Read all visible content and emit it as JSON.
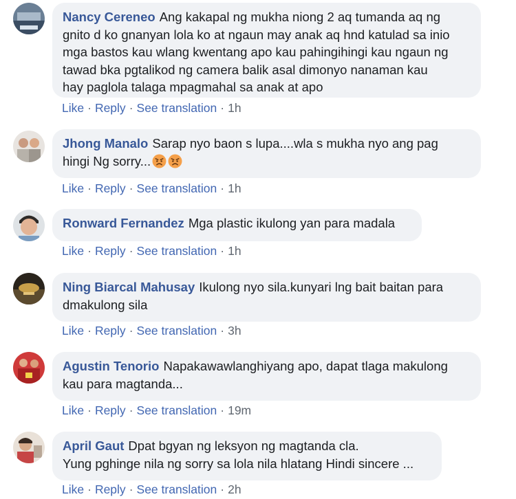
{
  "actions": {
    "like": "Like",
    "reply": "Reply",
    "see_translation": "See translation",
    "separator": "·"
  },
  "comments": [
    {
      "author": "Nancy Cereneo",
      "text": "Ang kakapal ng mukha niong 2 aq tumanda aq ng\ngnito d ko gnanyan lola ko at ngaun may anak aq hnd katulad sa inio\nmga bastos kau wlang kwentang apo kau pahingihingi kau ngaun ng\ntawad bka pgtalikod ng camera balik asal dimonyo nanaman kau\nhay paglola talaga mpagmahal sa anak at apo",
      "time": "1h"
    },
    {
      "author": "Jhong Manalo",
      "text": "Sarap nyo baon s lupa....wla s mukha nyo ang pag\nhingi Ng sorry...",
      "emojis": [
        "angry-face",
        "angry-face"
      ],
      "time": "1h"
    },
    {
      "author": "Ronward Fernandez",
      "text": "Mga plastic ikulong yan para madala",
      "time": "1h"
    },
    {
      "author": "Ning Biarcal Mahusay",
      "text": "Ikulong nyo sila.kunyari lng bait baitan para\ndmakulong sila",
      "time": "3h"
    },
    {
      "author": "Agustin Tenorio",
      "text": "Napakawawlanghiyang apo, dapat tlaga makulong\nkau para magtanda...",
      "time": "19m"
    },
    {
      "author": "April Gaut",
      "text": "Dpat bgyan ng leksyon ng magtanda cla.\nYung pghinge nila ng sorry sa lola nila hlatang Hindi sincere ...",
      "time": "2h"
    }
  ],
  "colors": {
    "author": "#385898",
    "link": "#4267b2",
    "bubble": "#f0f2f5",
    "text": "#1c1e21",
    "muted": "#606770"
  }
}
